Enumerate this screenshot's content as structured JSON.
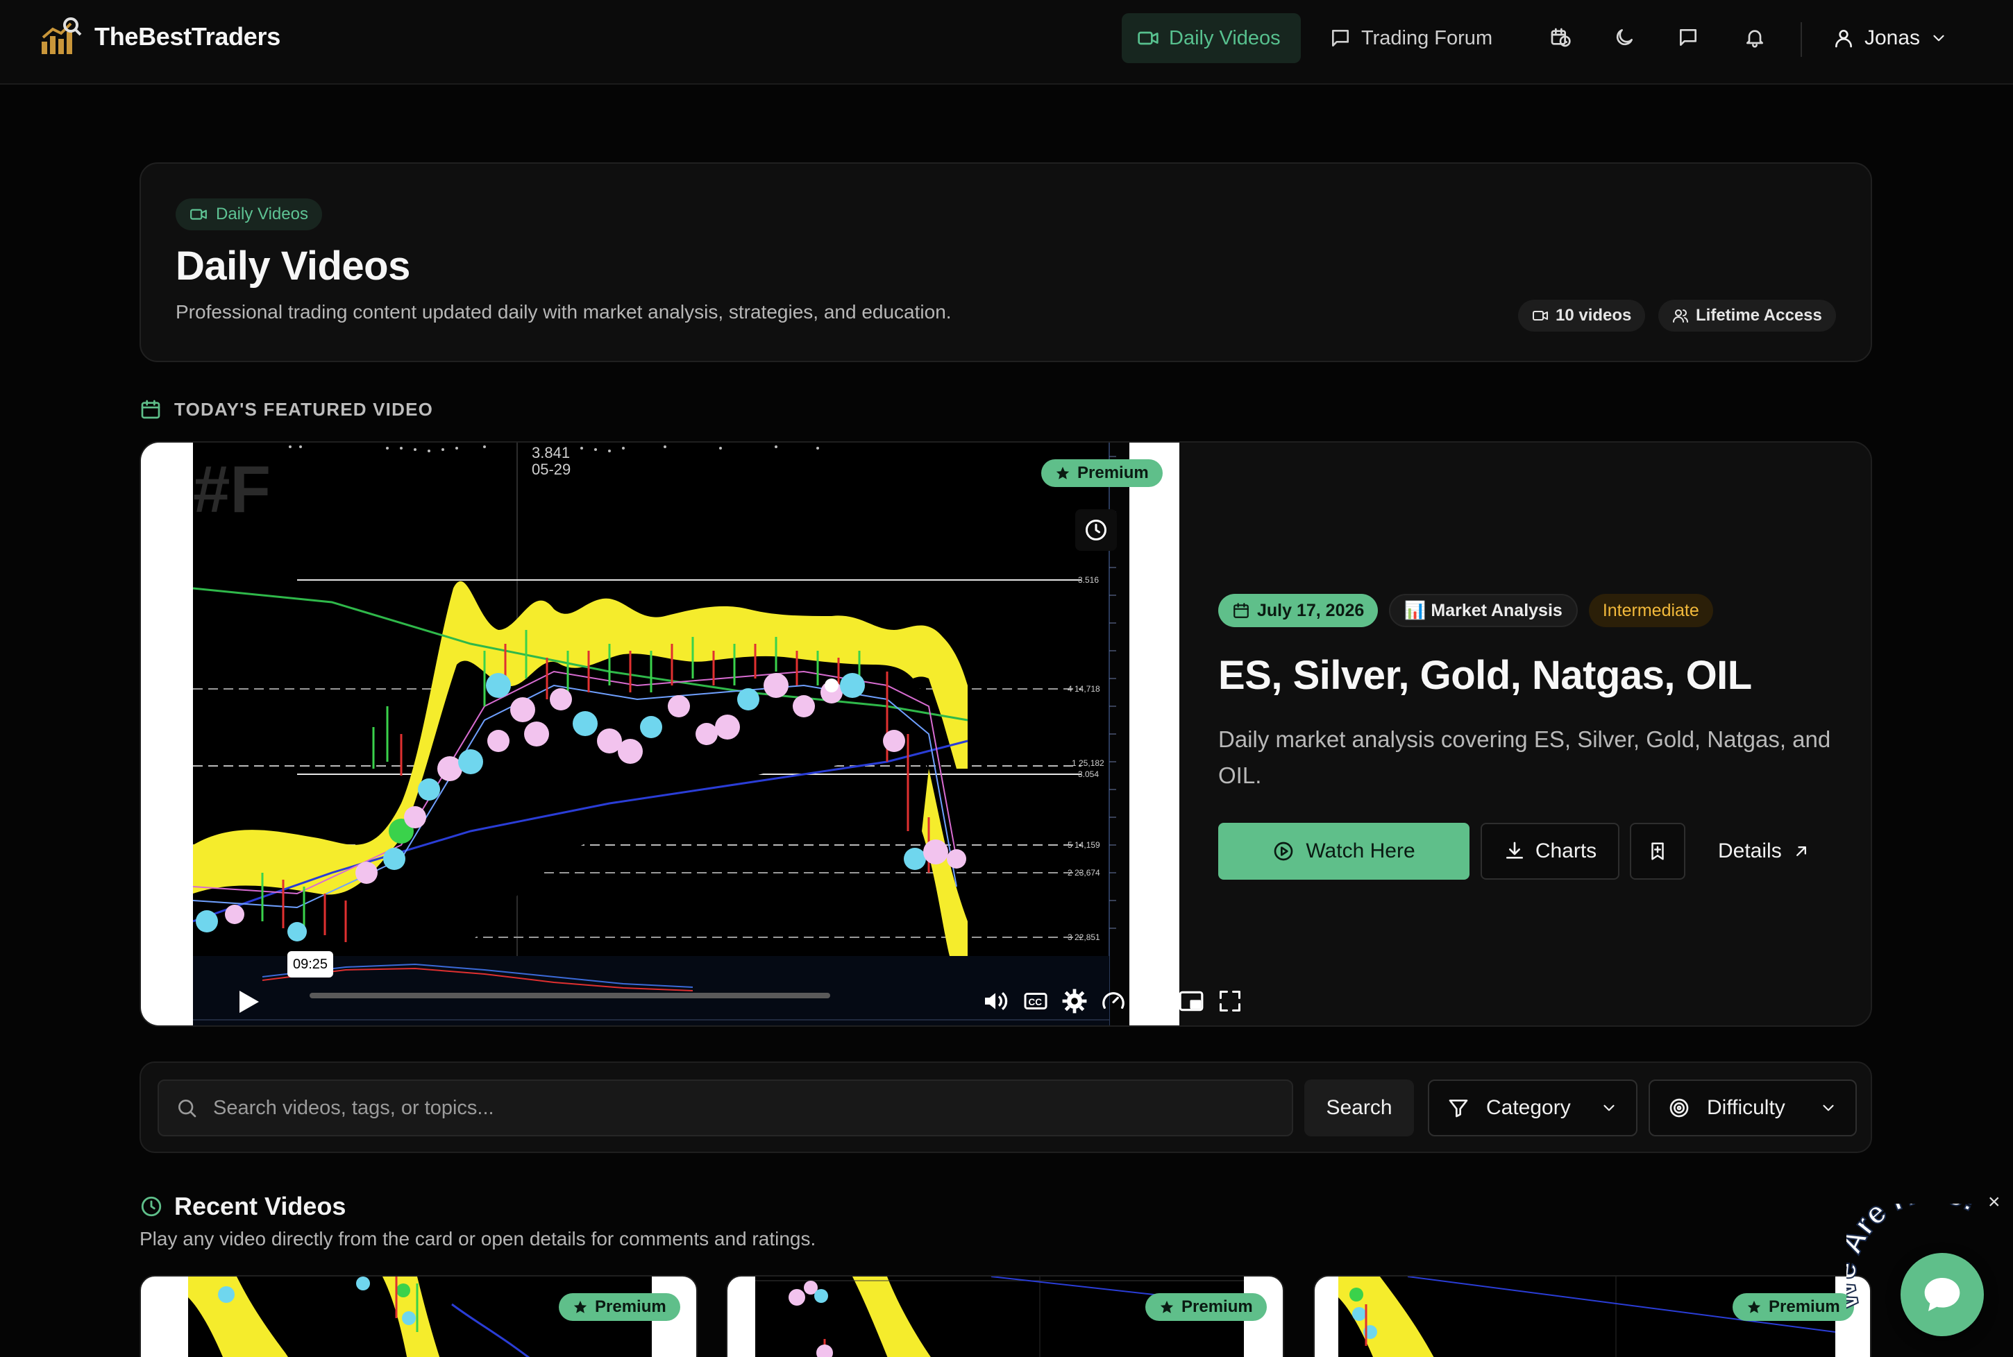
{
  "brand": {
    "name": "TheBestTraders"
  },
  "nav": {
    "daily_videos": "Daily Videos",
    "trading_forum": "Trading Forum",
    "user_name": "Jonas"
  },
  "hero": {
    "chip": "Daily Videos",
    "title": "Daily Videos",
    "subtitle": "Professional trading content updated daily with market analysis, strategies, and education.",
    "videos_count": "10 videos",
    "access": "Lifetime Access"
  },
  "featured": {
    "section_label": "TODAY'S FEATURED VIDEO",
    "badge": "Premium",
    "date": "July 17, 2026",
    "category": "📊 Market Analysis",
    "difficulty": "Intermediate",
    "title": "ES, Silver, Gold, Natgas, OIL",
    "description": "Daily market analysis covering ES, Silver, Gold, Natgas, and OIL.",
    "watch_label": "Watch Here",
    "charts_label": "Charts",
    "details_label": "Details",
    "player": {
      "hover_time": "09:25",
      "chart_price": "3.841",
      "chart_date": "05-29",
      "watermark": "#F",
      "price_labels": [
        "3.516",
        "4 14,718",
        "1 25,182",
        "3.054",
        "5 14,159",
        "2 23,674",
        "3 22,851"
      ]
    }
  },
  "search": {
    "placeholder": "Search videos, tags, or topics...",
    "value": "",
    "button_label": "Search",
    "category_label": "Category",
    "difficulty_label": "Difficulty"
  },
  "recent": {
    "title": "Recent Videos",
    "subtitle": "Play any video directly from the card or open details for comments and ratings.",
    "cards": [
      {
        "badge": "Premium"
      },
      {
        "badge": "Premium"
      },
      {
        "badge": "Premium"
      }
    ]
  },
  "chat": {
    "tagline": "We Are Here!",
    "close": "×"
  },
  "colors": {
    "accent": "#5fbf8a",
    "background": "#050505",
    "panel": "#0f0f0f",
    "difficulty": "#f2b93b",
    "chart_band": "#f5ec2c"
  },
  "icons": [
    "logo-chart-icon",
    "video-camera-icon",
    "chat-square-icon",
    "calendar-clock-icon",
    "moon-icon",
    "message-icon",
    "bell-icon",
    "user-icon",
    "chevron-down-icon",
    "calendar-icon",
    "star-icon",
    "play-circle-icon",
    "download-icon",
    "bookmark-icon",
    "arrow-up-right-icon",
    "search-icon",
    "filter-icon",
    "target-icon",
    "clock-icon",
    "chat-bubble-icon"
  ]
}
